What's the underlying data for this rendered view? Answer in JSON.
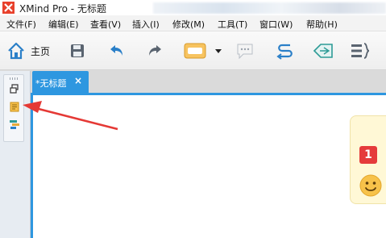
{
  "window": {
    "title": "XMind Pro - 无标题"
  },
  "menu": {
    "items": [
      "文件(F)",
      "编辑(E)",
      "查看(V)",
      "插入(I)",
      "修改(M)",
      "工具(T)",
      "窗口(W)",
      "帮助(H)"
    ]
  },
  "toolbar": {
    "home_label": "主页",
    "icons": [
      "home-icon",
      "save-icon",
      "undo-icon",
      "redo-icon",
      "topic-icon",
      "dropdown-arrow-icon",
      "callout-icon",
      "relationship-icon",
      "boundary-icon",
      "summary-icon"
    ]
  },
  "tabs": [
    {
      "label": "*无标题",
      "close": "×",
      "active": true
    }
  ],
  "canvas": {
    "markers": {
      "priority_badge": "1",
      "smiley": "smiley-icon"
    }
  },
  "colors": {
    "accent": "#2e97e0",
    "arrow": "#e53935",
    "card": "#fff8d6",
    "badge": "#e53b3b"
  }
}
